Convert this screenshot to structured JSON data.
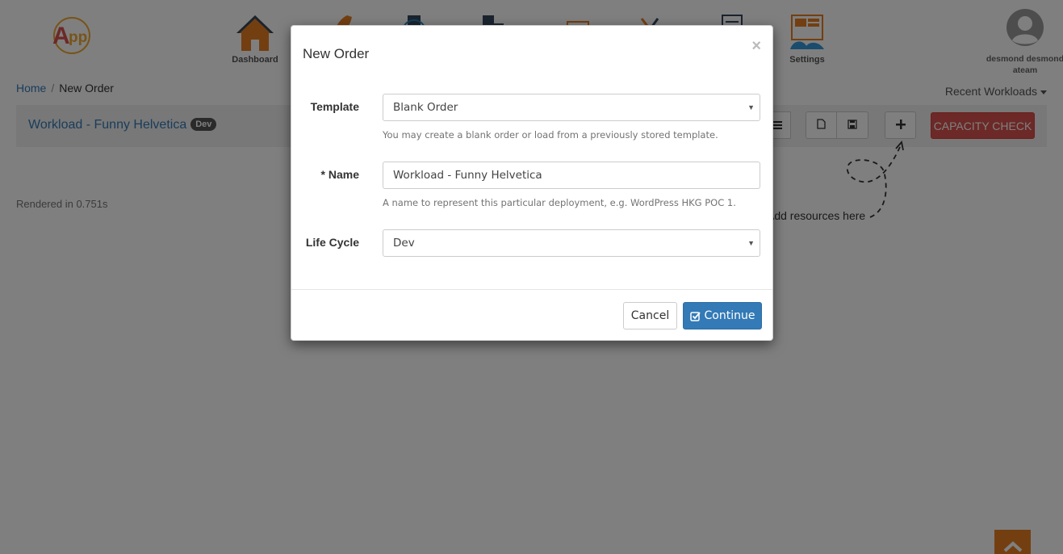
{
  "nav": {
    "items": [
      {
        "label": "Dashboard",
        "icon": "house-icon"
      },
      {
        "label": "",
        "icon": "rocket-icon"
      },
      {
        "label": "",
        "icon": "server-icon"
      },
      {
        "label": "",
        "icon": "servers-icon"
      },
      {
        "label": "",
        "icon": "windows-icon"
      },
      {
        "label": "",
        "icon": "tools-icon"
      },
      {
        "label": "",
        "icon": "document-stack-icon"
      },
      {
        "label": "Settings",
        "icon": "settings-monitor-icon"
      }
    ]
  },
  "user": {
    "name": "desmond desmond",
    "team": "ateam"
  },
  "breadcrumb": {
    "home": "Home",
    "separator": "/",
    "current": "New Order"
  },
  "recent_workloads": "Recent Workloads",
  "workload": {
    "title": "Workload - Funny Helvetica",
    "badge": "Dev"
  },
  "toolbar": {
    "capacity_check": "CAPACITY CHECK"
  },
  "hint": "Add resources here",
  "rendered": "Rendered in 0.751s",
  "modal": {
    "title": "New Order",
    "close": "×",
    "template": {
      "label": "Template",
      "value": "Blank Order",
      "help": "You may create a blank order or load from a previously stored template."
    },
    "name": {
      "label": "* Name",
      "value": "Workload - Funny Helvetica",
      "help": "A name to represent this particular deployment, e.g. WordPress HKG POC 1."
    },
    "lifecycle": {
      "label": "Life Cycle",
      "value": "Dev"
    },
    "cancel": "Cancel",
    "continue": "Continue"
  },
  "colors": {
    "brand_orange": "#e67e22",
    "primary": "#337ab7",
    "danger": "#d9534f"
  }
}
